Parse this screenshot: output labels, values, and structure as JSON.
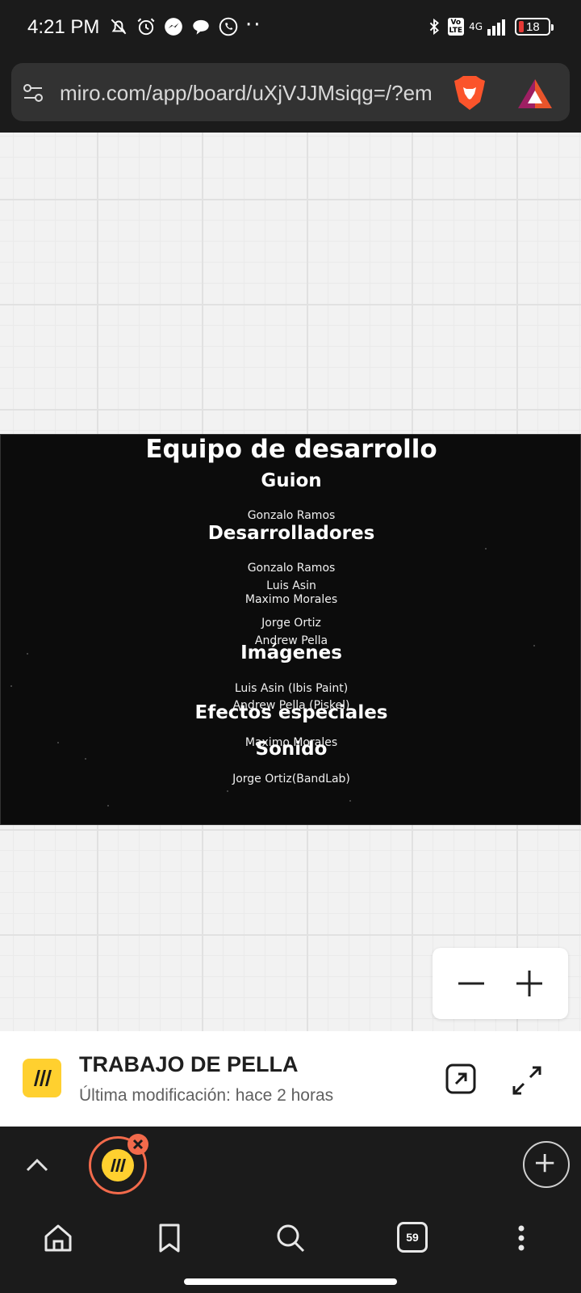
{
  "status_bar": {
    "time": "4:21 PM",
    "dots": "··",
    "volte": "Vo\nLTE",
    "network": "4G",
    "battery": "18"
  },
  "browser": {
    "url": "miro.com/app/board/uXjVJJMsiqg=/?em"
  },
  "credits": {
    "title": "Equipo de desarrollo",
    "sections": {
      "guion": "Guion",
      "desarrolladores": "Desarrolladores",
      "imagenes": "Imágenes",
      "efectos": "Efectos especiales",
      "sonido": "Sonido"
    },
    "names": {
      "guion_1": "Gonzalo Ramos",
      "dev_1": "Gonzalo Ramos",
      "dev_2": "Luis Asin",
      "dev_3": "Maximo Morales",
      "dev_4": "Jorge Ortiz",
      "dev_5": "Andrew Pella",
      "img_1": "Luis Asin (Ibis Paint)",
      "img_2": "Andrew Pella (Piskel)",
      "fx_1": "Maximo Morales",
      "sound_1": "Jorge Ortiz(BandLab)"
    }
  },
  "board": {
    "title": "TRABAJO DE PELLA",
    "subtitle": "Última modificación: hace 2 horas"
  },
  "tabs": {
    "count": "59"
  },
  "colors": {
    "miro_yellow": "#ffd02f",
    "brave_orange": "#f26a4b",
    "credits_bg": "#0c0c0c"
  }
}
